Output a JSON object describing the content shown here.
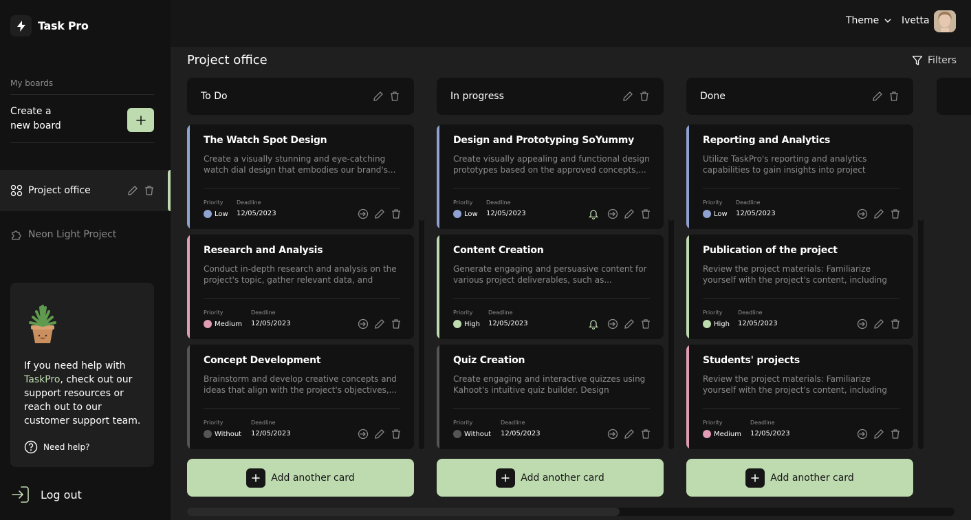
{
  "brand": {
    "name": "Task Pro"
  },
  "sidebar": {
    "my_boards_label": "My boards",
    "create_board_line1": "Create a",
    "create_board_line2": "new board",
    "boards": [
      {
        "title": "Project office",
        "active": true
      },
      {
        "title": "Neon Light Project",
        "active": false
      }
    ],
    "help": {
      "text_before": "If you need help with ",
      "highlight": "TaskPro",
      "text_after": ", check out our support resources or reach out to our customer support team.",
      "link": "Need help?"
    },
    "logout": "Log out"
  },
  "header": {
    "theme": "Theme",
    "user": "Ivetta"
  },
  "main": {
    "title": "Project office",
    "filters": "Filters"
  },
  "columns": [
    {
      "title": "To Do",
      "add_label": "Add another card",
      "cards": [
        {
          "title": "The Watch Spot Design",
          "description": "Create a visually stunning and eye-catching watch dial design that embodies our brand's...",
          "priority_label": "Priority",
          "priority": "Low",
          "deadline_label": "Deadline",
          "deadline": "12/05/2023",
          "bell": false
        },
        {
          "title": "Research and Analysis",
          "description": "Conduct in-depth research and analysis on the project's topic, gather relevant data, and identify...",
          "priority_label": "Priority",
          "priority": "Medium",
          "deadline_label": "Deadline",
          "deadline": "12/05/2023",
          "bell": false
        },
        {
          "title": "Concept Development",
          "description": "Brainstorm and develop creative concepts and ideas that align with the project's objectives,...",
          "priority_label": "Priority",
          "priority": "Without",
          "deadline_label": "Deadline",
          "deadline": "12/05/2023",
          "bell": false
        }
      ]
    },
    {
      "title": "In progress",
      "add_label": "Add another card",
      "cards": [
        {
          "title": "Design and Prototyping SoYummy",
          "description": "Create visually appealing and functional design prototypes based on the approved concepts,...",
          "priority_label": "Priority",
          "priority": "Low",
          "deadline_label": "Deadline",
          "deadline": "12/05/2023",
          "bell": true
        },
        {
          "title": "Content Creation",
          "description": "Generate engaging and persuasive content for various project deliverables, such as...",
          "priority_label": "Priority",
          "priority": "High",
          "deadline_label": "Deadline",
          "deadline": "12/05/2023",
          "bell": true
        },
        {
          "title": "Quiz Creation",
          "description": "Create engaging and interactive quizzes using Kahoot's intuitive quiz builder. Design questions,...",
          "priority_label": "Priority",
          "priority": "Without",
          "deadline_label": "Deadline",
          "deadline": "12/05/2023",
          "bell": false
        }
      ]
    },
    {
      "title": "Done",
      "add_label": "Add another card",
      "cards": [
        {
          "title": "Reporting and Analytics",
          "description": "Utilize TaskPro's reporting and analytics capabilities to gain insights into project progress,...",
          "priority_label": "Priority",
          "priority": "Low",
          "deadline_label": "Deadline",
          "deadline": "12/05/2023",
          "bell": false
        },
        {
          "title": "Publication of the project",
          "description": "Review the project materials: Familiarize yourself with the project's content, including text, images,...",
          "priority_label": "Priority",
          "priority": "High",
          "deadline_label": "Deadline",
          "deadline": "12/05/2023",
          "bell": false
        },
        {
          "title": "Students' projects",
          "description": "Review the project materials: Familiarize yourself with the project's content, including text, images,...",
          "priority_label": "Priority",
          "priority": "Medium",
          "deadline_label": "Deadline",
          "deadline": "12/05/2023",
          "bell": false
        }
      ]
    }
  ],
  "colors": {
    "accent": "#bedbb0",
    "priority_low": "#8fa1d0",
    "priority_medium": "#e09cb5",
    "priority_high": "#bedbb0",
    "priority_without": "#555555"
  },
  "icons": {
    "logo": "lightning-icon",
    "board_active": "four-circles-icon",
    "board_inactive": "puzzle-icon",
    "edit": "pencil-icon",
    "delete": "trash-icon",
    "move": "arrow-circle-right-icon",
    "notify": "bell-icon",
    "filter": "funnel-icon",
    "help": "question-circle-icon",
    "logout": "logout-icon",
    "plus": "plus-icon"
  }
}
